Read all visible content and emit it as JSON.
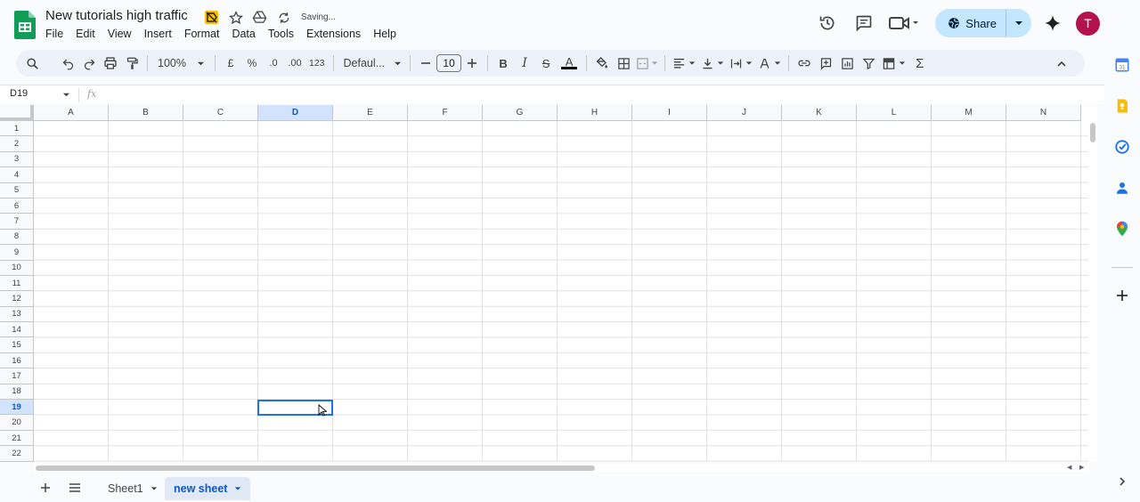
{
  "header": {
    "doc_title": "New tutorials high traffic",
    "saving_status": "Saving...",
    "share_label": "Share",
    "avatar_letter": "T",
    "menu": [
      "File",
      "Edit",
      "View",
      "Insert",
      "Format",
      "Data",
      "Tools",
      "Extensions",
      "Help"
    ]
  },
  "toolbar": {
    "zoom": "100%",
    "currency": "£",
    "percent": "%",
    "decrease_decimal": ".0",
    "increase_decimal": ".00",
    "number_format": "123",
    "font": "Defaul...",
    "font_size": "10",
    "bold": "B",
    "italic": "I",
    "strike": "S",
    "text_color": "A",
    "sum": "Σ"
  },
  "formula_bar": {
    "name_box": "D19",
    "fx": "fx"
  },
  "grid": {
    "columns": [
      "A",
      "B",
      "C",
      "D",
      "E",
      "F",
      "G",
      "H",
      "I",
      "J",
      "K",
      "L",
      "M",
      "N"
    ],
    "rows": [
      "1",
      "2",
      "3",
      "4",
      "5",
      "6",
      "7",
      "8",
      "9",
      "10",
      "11",
      "12",
      "13",
      "14",
      "15",
      "16",
      "17",
      "18",
      "19",
      "20",
      "21",
      "22"
    ],
    "selected_column": "D",
    "selected_row": "19"
  },
  "sheets": {
    "tabs": [
      "Sheet1",
      "new sheet"
    ],
    "active": "new sheet"
  },
  "colors": {
    "accent": "#0b57d0",
    "share_bg": "#c2e7ff",
    "avatar_bg": "#b3124e",
    "selection": "#1a73e8"
  }
}
